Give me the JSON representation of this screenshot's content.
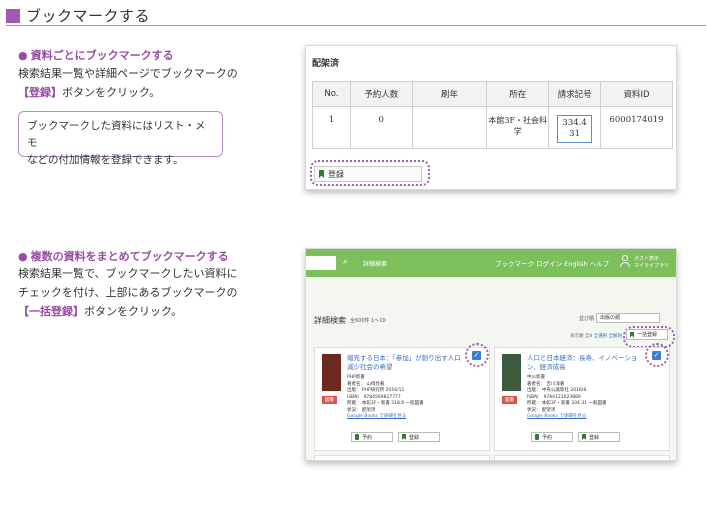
{
  "heading": "ブックマークする",
  "section1": {
    "title": "資料ごとにブックマークする",
    "line1": "検索結果一覧や詳細ページでブックマークの",
    "bracket": "【登録】",
    "line2_rest": "ボタンをクリック。",
    "note_line1": "ブックマークした資料にはリスト・メモ",
    "note_line2": "などの付加情報を登録できます。"
  },
  "section2": {
    "title": "複数の資料をまとめてブックマークする",
    "line1": "検索結果一覧で、ブックマークしたい資料に",
    "line2": "チェックを付け、上部にあるブックマークの",
    "bracket": "【一括登録】",
    "line3_rest": "ボタンをクリック。"
  },
  "shot1": {
    "caption": "配架済",
    "columns": [
      "No.",
      "予約人数",
      "刷年",
      "所在",
      "請求記号",
      "資料ID"
    ],
    "row": {
      "no": "1",
      "reservations": "0",
      "print_year": "",
      "location": "本館3F・社会科学",
      "call_no_1": "334.4",
      "call_no_2": "31",
      "item_id": "6000174019"
    },
    "register_label": "登録"
  },
  "shot2": {
    "search_icon": "search-icon",
    "advanced_label": "詳細検索",
    "nav": "ブックマーク  ログイン  English  ヘルプ",
    "mylib_top": "ポスト表示",
    "mylib_bottom": "マイライブラリ",
    "result_title": "詳細検索",
    "result_count": "全600件 1～10",
    "sort_label": "並び順",
    "sort_value": "出版の順",
    "links_prefix": "表示順 全8 ",
    "links": "全選択 全解除",
    "bulk_label": "一括登録",
    "cards": [
      {
        "title": "縮充する日本：「参加」が創り出す人口減少社会の希望",
        "meta": [
          "PHP新書",
          "著者名： 山崎亮著",
          "出版： PHP研究所 2016/11",
          "ISBN： 9784569827777",
          "所蔵： 本館3F・新書  318.6  一般図書",
          "状況： 配架済"
        ],
        "google": "Google Books で詳細を見る",
        "tag": "図書"
      },
      {
        "title": "人口と日本経済：長寿、イノベーション、経済成長",
        "meta": [
          "中公新書",
          "著者名： 吉川洋著",
          "出版： 中央公論新社 2016/8",
          "ISBN： 9784121023889",
          "所蔵： 本館3F・新書  334.31  一般図書",
          "状況： 配架済"
        ],
        "google": "Google Books で詳細を見る",
        "tag": "図書"
      }
    ],
    "reserve_label": "予約",
    "register_label": "登録"
  }
}
